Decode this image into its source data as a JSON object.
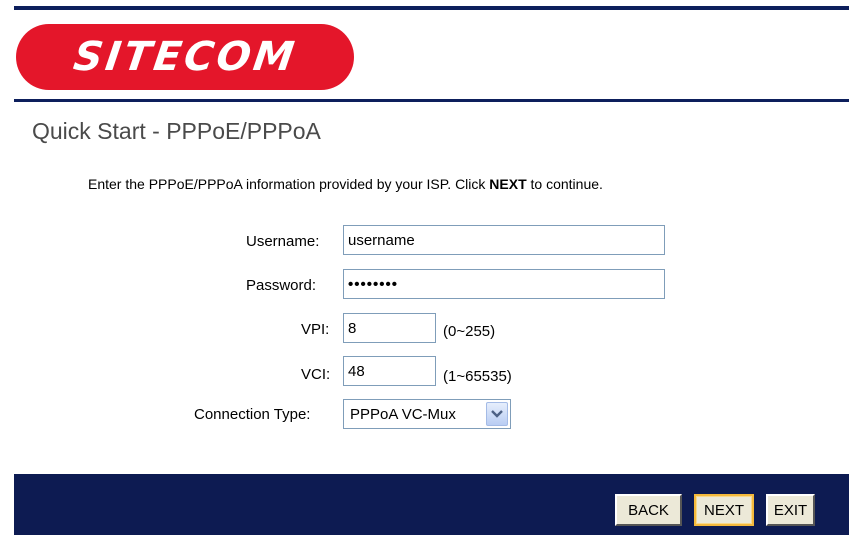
{
  "brand": {
    "logo_text": "SITECOM",
    "accent_color": "#e4162a",
    "navy_color": "#0d1f5c"
  },
  "page": {
    "title": "Quick Start - PPPoE/PPPoA",
    "instructions_before": "Enter the PPPoE/PPPoA information provided by your ISP. Click ",
    "instructions_bold": "NEXT",
    "instructions_after": " to continue."
  },
  "form": {
    "username_label": "Username:",
    "username_value": "username",
    "password_label": "Password:",
    "password_value": "••••••••",
    "vpi_label": "VPI:",
    "vpi_value": "8",
    "vpi_hint": "(0~255)",
    "vci_label": "VCI:",
    "vci_value": "48",
    "vci_hint": "(1~65535)",
    "connection_type_label": "Connection Type:",
    "connection_type_value": "PPPoA VC-Mux",
    "connection_type_icon": "chevron-down-icon"
  },
  "buttons": {
    "back_label": "BACK",
    "next_label": "NEXT",
    "exit_label": "EXIT"
  }
}
